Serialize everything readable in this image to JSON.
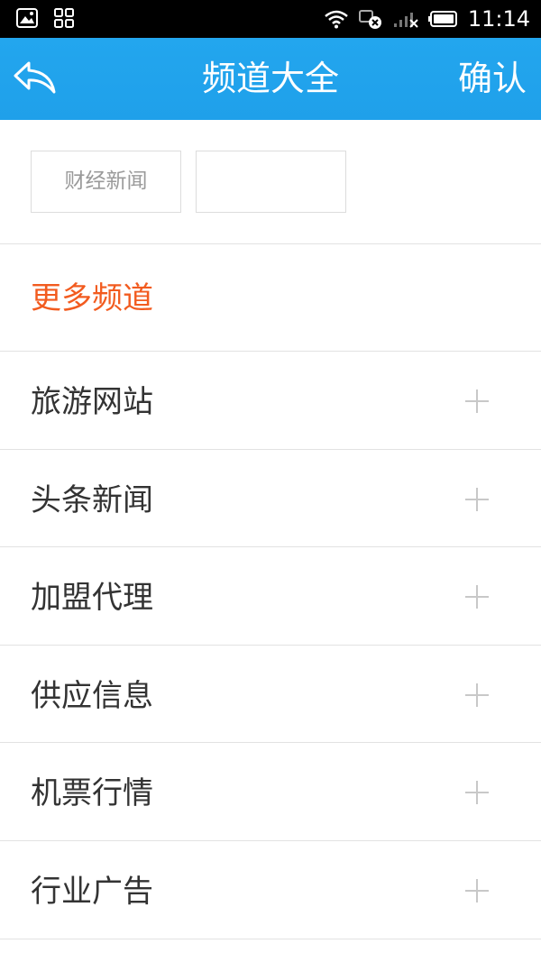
{
  "status_bar": {
    "time": "11:14",
    "icons": [
      "image-icon",
      "apps-icon",
      "wifi-icon",
      "data-off-icon",
      "signal-icon",
      "battery-icon"
    ]
  },
  "header": {
    "title": "频道大全",
    "confirm_label": "确认",
    "background_color": "#1fa0ea"
  },
  "selected_channels": [
    {
      "label": "财经新闻"
    },
    {
      "label": ""
    }
  ],
  "more_channels": {
    "title": "更多频道",
    "accent_color": "#f25b1f",
    "items": [
      {
        "label": "旅游网站"
      },
      {
        "label": "头条新闻"
      },
      {
        "label": "加盟代理"
      },
      {
        "label": "供应信息"
      },
      {
        "label": "机票行情"
      },
      {
        "label": "行业广告"
      }
    ]
  }
}
